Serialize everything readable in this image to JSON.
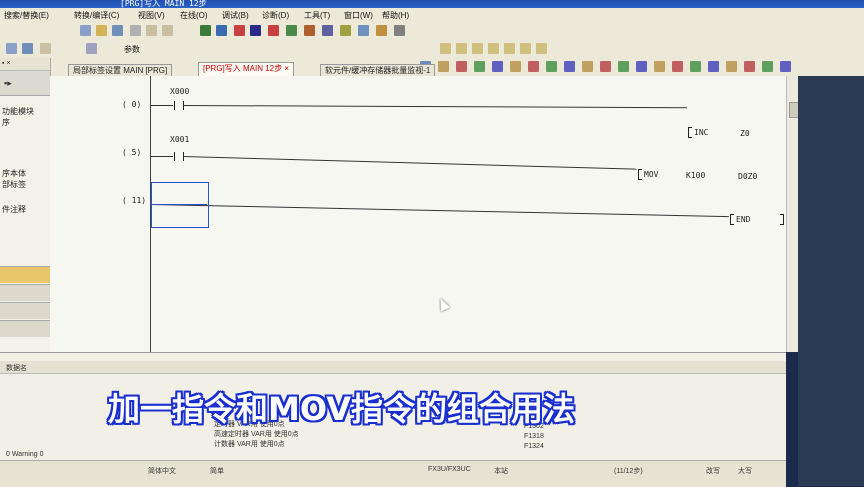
{
  "window": {
    "title": "[PRG]写入 MAIN 12步"
  },
  "menu": [
    {
      "label": "搜索/替换(E)"
    },
    {
      "label": "转换/编译(C)"
    },
    {
      "label": "视图(V)"
    },
    {
      "label": "在线(O)"
    },
    {
      "label": "调试(B)"
    },
    {
      "label": "诊断(D)"
    },
    {
      "label": "工具(T)"
    },
    {
      "label": "窗口(W)"
    },
    {
      "label": "帮助(H)"
    }
  ],
  "toolbar": {
    "param_label": "参数"
  },
  "left_panel": {
    "head": "▪ ×",
    "items": [
      "功能模块",
      "序",
      "序本体",
      "部标签",
      "件注释"
    ]
  },
  "tabs": [
    {
      "label": "局部标签设置 MAIN [PRG]"
    },
    {
      "label": "[PRG]写入 MAIN 12步"
    },
    {
      "label": "软元件/缓冲存储器批量监视-1"
    }
  ],
  "ladder": {
    "rungs": [
      {
        "step": "( 0)",
        "device": "X000",
        "instr": "INC",
        "op1": "Z0",
        "op2": ""
      },
      {
        "step": "( 5)",
        "device": "X001",
        "instr": "MOV",
        "op1": "K100",
        "op2": "D0Z0"
      },
      {
        "step": "( 11)",
        "device": "",
        "instr": "END",
        "op1": "",
        "op2": ""
      }
    ]
  },
  "output": {
    "header": "数据名",
    "lines": [
      "定时器 VAR用 使用0点",
      "高速定时器 VAR用 使用0点",
      "计数器 VAR用 使用0点"
    ],
    "right_lines": [
      "F1302",
      "F1318",
      "F1324"
    ],
    "warning": "0 Warning 0"
  },
  "status": {
    "cells": [
      "简体中文",
      "简单",
      "FX3U/FX3UC",
      "本站",
      "(11/12步)",
      "改写",
      "大写"
    ]
  },
  "caption": "加一指令和MOV指令的组合用法"
}
